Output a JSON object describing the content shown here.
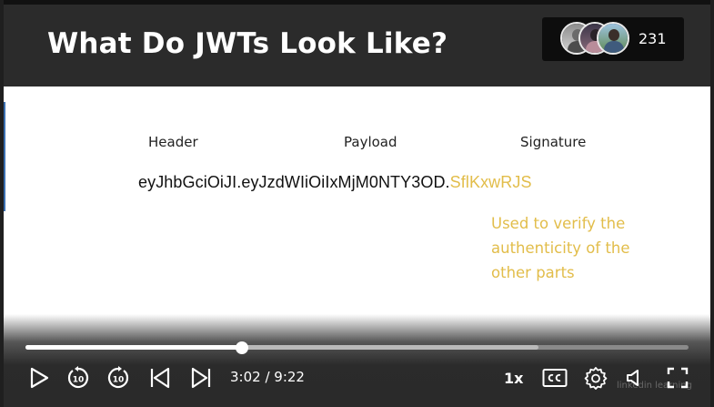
{
  "slide": {
    "title": "What Do JWTs Look Like?",
    "labels": {
      "header": "Header",
      "payload": "Payload",
      "signature": "Signature"
    },
    "token": {
      "main": "eyJhbGciOiJI.eyJzdWIiOiIxMjM0NTY3OD.",
      "signature": "SflKxwRJS"
    },
    "signature_note": "Used to verify the authenticity of the other parts"
  },
  "viewers": {
    "count": "231"
  },
  "player": {
    "progress_played": 0.327,
    "progress_buffered": 0.774,
    "time": "3:02 / 9:22",
    "speed": "1x",
    "skip_back_seconds": "10",
    "skip_forward_seconds": "10"
  },
  "watermark": "linkedin learning",
  "colors": {
    "accent_signature": "#e2bd4a",
    "title_bar": "#2b2b2b"
  },
  "icons": [
    "play-icon",
    "replay-10-icon",
    "forward-10-icon",
    "previous-icon",
    "next-icon",
    "closed-captions-icon",
    "gear-icon",
    "volume-icon",
    "fullscreen-icon"
  ]
}
